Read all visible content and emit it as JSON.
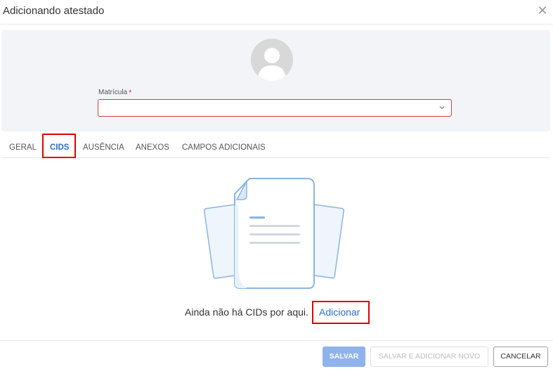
{
  "modal": {
    "title": "Adicionando atestado",
    "close_icon": "close-icon"
  },
  "header": {
    "avatar_icon": "user-avatar-icon",
    "field": {
      "label": "Matrícula",
      "required_mark": "*",
      "value": "",
      "chevron_icon": "chevron-down-icon",
      "error_color": "#d33c3c"
    }
  },
  "tabs": [
    {
      "label": "GERAL",
      "active": false
    },
    {
      "label": "CIDS",
      "active": true
    },
    {
      "label": "AUSÊNCIA",
      "active": false
    },
    {
      "label": "ANEXOS",
      "active": false
    },
    {
      "label": "CAMPOS ADICIONAIS",
      "active": false
    }
  ],
  "empty_state": {
    "illustration_icon": "empty-documents-icon",
    "message": "Ainda não há CIDs por aqui.",
    "link_label": "Adicionar"
  },
  "footer": {
    "save_label": "SALVAR",
    "save_and_new_label": "SALVAR E ADICIONAR NOVO",
    "cancel_label": "CANCELAR"
  },
  "colors": {
    "accent": "#2a6fc9",
    "highlight_box": "#e00000",
    "header_bg": "#f3f4f8"
  }
}
